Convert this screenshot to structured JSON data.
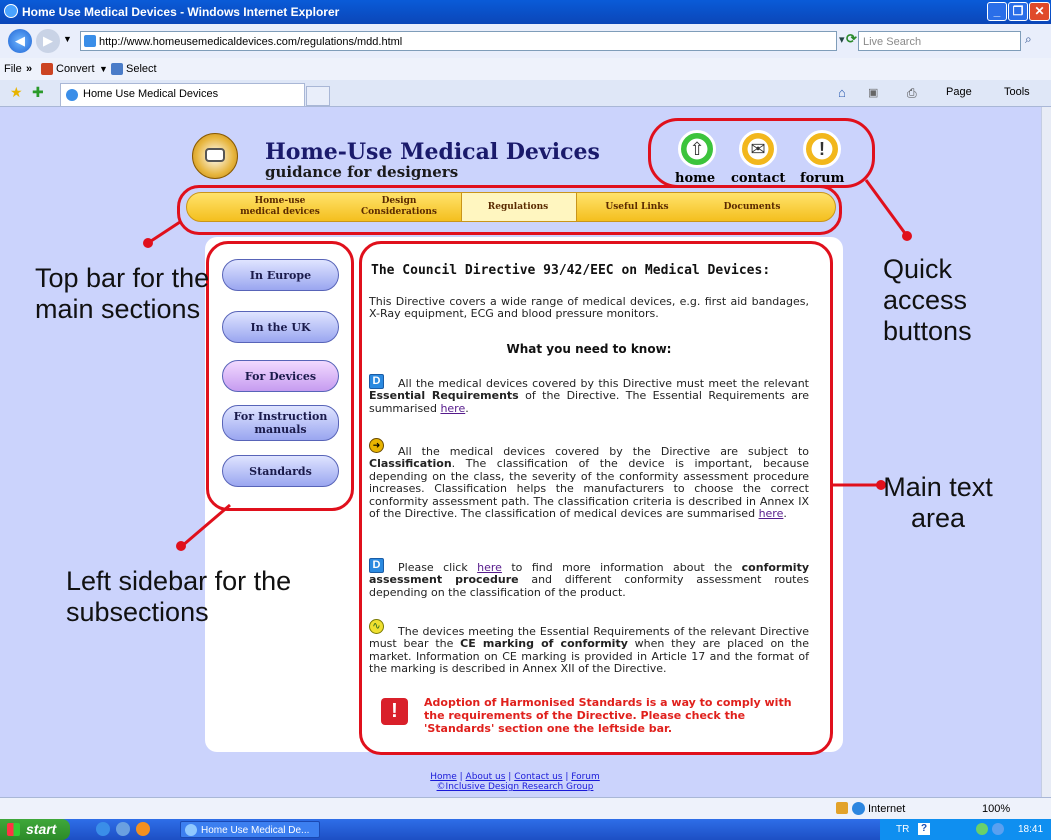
{
  "browser": {
    "window_title": "Home Use Medical Devices - Windows Internet Explorer",
    "url": "http://www.homeusemedicaldevices.com/regulations/mdd.html",
    "search_placeholder": "Live Search",
    "menu_file": "File",
    "menu_convert": "Convert",
    "menu_select": "Select",
    "tab_title": "Home Use Medical Devices",
    "cmd_page": "Page",
    "cmd_tools": "Tools",
    "status_zone": "Internet",
    "zoom": "100%"
  },
  "taskbar": {
    "start": "start",
    "task_item": "Home Use Medical De...",
    "lang": "TR",
    "clock": "18:41"
  },
  "site": {
    "title": "Home-Use Medical Devices",
    "subtitle": "guidance for designers",
    "quick": [
      "home",
      "contact",
      "forum"
    ],
    "nav": [
      {
        "line1": "Home-use",
        "line2": "medical devices"
      },
      {
        "line1": "Design",
        "line2": "Considerations"
      },
      {
        "line1": "Regulations",
        "line2": ""
      },
      {
        "line1": "Useful Links",
        "line2": ""
      },
      {
        "line1": "Documents",
        "line2": ""
      }
    ],
    "sidebar": [
      {
        "line1": "In Europe",
        "line2": ""
      },
      {
        "line1": "In the UK",
        "line2": ""
      },
      {
        "line1": "For Devices",
        "line2": ""
      },
      {
        "line1": "For Instruction",
        "line2": "manuals"
      },
      {
        "line1": "Standards",
        "line2": ""
      }
    ],
    "main": {
      "heading": "The Council Directive 93/42/EEC on Medical Devices:",
      "intro": "This Directive covers a wide range of medical devices, e.g. first aid bandages, X-Ray equipment, ECG and blood pressure monitors.",
      "subheading": "What you need to know:",
      "p1_a": "All the medical devices covered by this Directive must meet the relevant ",
      "p1_b": "Essential Requirements",
      "p1_c": " of the Directive. The Essential Requirements are summarised ",
      "p1_link": "here",
      "p1_end": ".",
      "p2_a": "All the medical devices covered by the Directive are subject to ",
      "p2_b": "Classification",
      "p2_c": ". The classification of the device is important, because depending on the class, the severity of the conformity assessment procedure increases. Classification helps the manufacturers to choose the correct conformity assessment path. The classification criteria is described in Annex IX of the Directive. The classification of medical devices are summarised ",
      "p2_link": "here",
      "p2_end": ".",
      "p3_a": "Please click ",
      "p3_link": "here",
      "p3_b": " to find more information about the ",
      "p3_c": "conformity assessment procedure",
      "p3_d": " and different conformity assessment routes depending on the classification of the product.",
      "p4_a": "The devices meeting the Essential Requirements of the relevant Directive must bear the ",
      "p4_b": "CE marking of conformity",
      "p4_c": " when they are placed on the market. Information on CE marking is provided in Article 17 and the format of the marking is described in Annex XII of the Directive.",
      "warning": "Adoption of Harmonised Standards is a way to comply with the requirements of the Directive. Please check the 'Standards' section one the leftside bar."
    },
    "footer": {
      "home": "Home",
      "sep": " | ",
      "about": "About us",
      "contact": "Contact us",
      "forum": "Forum",
      "credit": "©Inclusive Design Research Group"
    }
  },
  "annotations": {
    "top_bar": "Top bar for the main sections",
    "quick_access": "Quick access buttons",
    "main_text": "Main text area",
    "left_sidebar": "Left sidebar for the subsections"
  }
}
